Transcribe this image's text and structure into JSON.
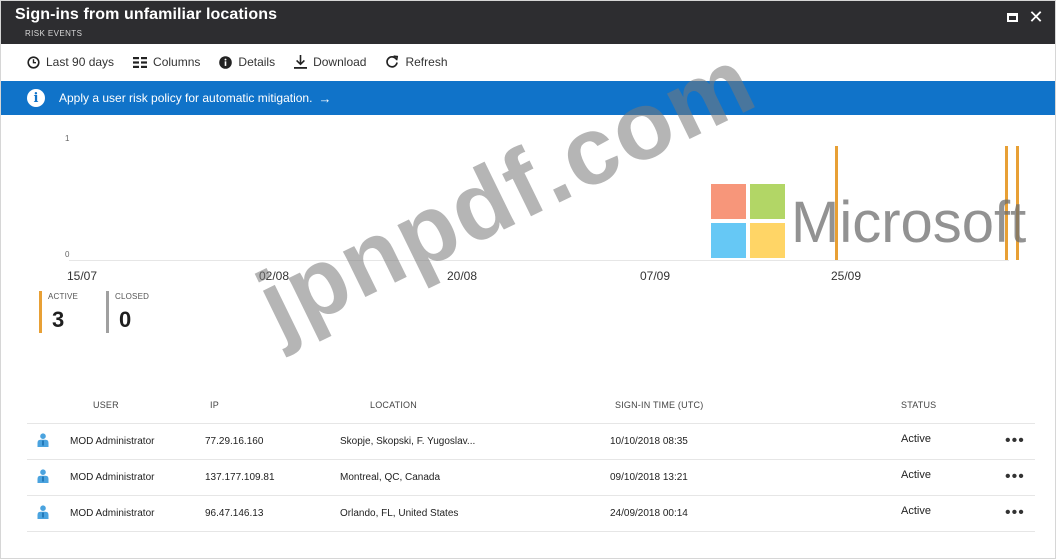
{
  "header": {
    "title": "Sign-ins from unfamiliar locations",
    "subtitle": "RISK EVENTS",
    "maximize_icon": "maximize-icon",
    "close_icon": "close-icon",
    "close_glyph": "✕"
  },
  "toolbar": {
    "items": [
      {
        "label": "Last 90 days",
        "icon": "clock-icon"
      },
      {
        "label": "Columns",
        "icon": "columns-icon"
      },
      {
        "label": "Details",
        "icon": "info-icon"
      },
      {
        "label": "Download",
        "icon": "download-icon"
      },
      {
        "label": "Refresh",
        "icon": "refresh-icon"
      }
    ]
  },
  "banner": {
    "text": "Apply a user risk policy for automatic mitigation.",
    "arrow": "→",
    "info_glyph": "i",
    "color": "#1073c9"
  },
  "chart_data": {
    "type": "bar",
    "y_ticks": [
      "1",
      "0"
    ],
    "x_ticks": [
      "15/07",
      "02/08",
      "20/08",
      "07/09",
      "25/09"
    ],
    "ylim": [
      0,
      1
    ],
    "bar_color": "#e8a035",
    "series": [
      {
        "x": [
          "24/09",
          "10/10",
          "11/10"
        ],
        "values": [
          1,
          1,
          1
        ]
      }
    ]
  },
  "counters": [
    {
      "label": "ACTIVE",
      "value": "3",
      "color": "#e8a035"
    },
    {
      "label": "CLOSED",
      "value": "0",
      "color": "#a0a0a0"
    }
  ],
  "table": {
    "columns": [
      "USER",
      "IP",
      "LOCATION",
      "SIGN-IN TIME (UTC)",
      "STATUS"
    ],
    "rows": [
      {
        "user": "MOD Administrator",
        "ip": "77.29.16.160",
        "location": "Skopje, Skopski, F. Yugoslav...",
        "time": "10/10/2018 08:35",
        "status": "Active",
        "more": "•••"
      },
      {
        "user": "MOD Administrator",
        "ip": "137.177.109.81",
        "location": "Montreal, QC, Canada",
        "time": "09/10/2018 13:21",
        "status": "Active",
        "more": "•••"
      },
      {
        "user": "MOD Administrator",
        "ip": "96.47.146.13",
        "location": "Orlando, FL, United States",
        "time": "24/09/2018 00:14",
        "status": "Active",
        "more": "•••"
      }
    ]
  },
  "watermark": {
    "text": "jpnpdf.com",
    "brand": "Microsoft",
    "logo_colors": [
      "#f25022",
      "#7fba00",
      "#00a4ef",
      "#ffb900"
    ]
  }
}
